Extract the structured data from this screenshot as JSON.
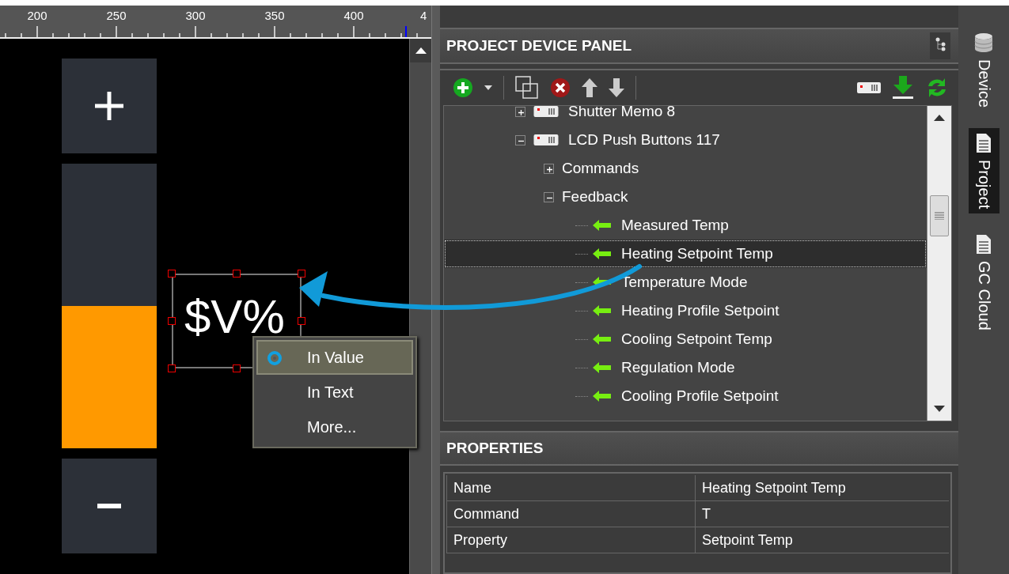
{
  "ruler": {
    "labels": [
      "200",
      "250",
      "300",
      "350",
      "400",
      "4"
    ]
  },
  "canvas": {
    "value_text": "$V%",
    "slider": {
      "level": 0.5
    },
    "context_menu": [
      {
        "label": "In Value",
        "selected": true
      },
      {
        "label": "In Text",
        "selected": false
      },
      {
        "label": "More...",
        "selected": false
      }
    ]
  },
  "device_panel": {
    "title": "PROJECT DEVICE PANEL",
    "tree": [
      {
        "label": "Shutter Memo 8",
        "kind": "device",
        "expanded": false,
        "selected": false
      },
      {
        "label": "LCD Push Buttons 117",
        "kind": "device",
        "expanded": true,
        "selected": false,
        "children": [
          {
            "label": "Commands",
            "kind": "folder",
            "expanded": false,
            "selected": false
          },
          {
            "label": "Feedback",
            "kind": "folder",
            "expanded": true,
            "selected": false,
            "children": [
              {
                "label": "Measured Temp",
                "kind": "feedback",
                "selected": false
              },
              {
                "label": "Heating Setpoint Temp",
                "kind": "feedback",
                "selected": true
              },
              {
                "label": "Temperature Mode",
                "kind": "feedback",
                "selected": false
              },
              {
                "label": "Heating Profile Setpoint",
                "kind": "feedback",
                "selected": false
              },
              {
                "label": "Cooling Setpoint Temp",
                "kind": "feedback",
                "selected": false
              },
              {
                "label": "Regulation Mode",
                "kind": "feedback",
                "selected": false
              },
              {
                "label": "Cooling Profile Setpoint",
                "kind": "feedback",
                "selected": false
              }
            ]
          }
        ]
      }
    ]
  },
  "properties": {
    "title": "PROPERTIES",
    "rows": [
      {
        "name": "Name",
        "value": "Heating Setpoint Temp"
      },
      {
        "name": "Command",
        "value": "T"
      },
      {
        "name": "Property",
        "value": "Setpoint Temp"
      }
    ]
  },
  "side_tabs": [
    {
      "label": "Device",
      "kind": "database",
      "selected": false
    },
    {
      "label": "Project",
      "kind": "document",
      "selected": true
    },
    {
      "label": "GC Cloud",
      "kind": "document",
      "selected": false
    }
  ]
}
